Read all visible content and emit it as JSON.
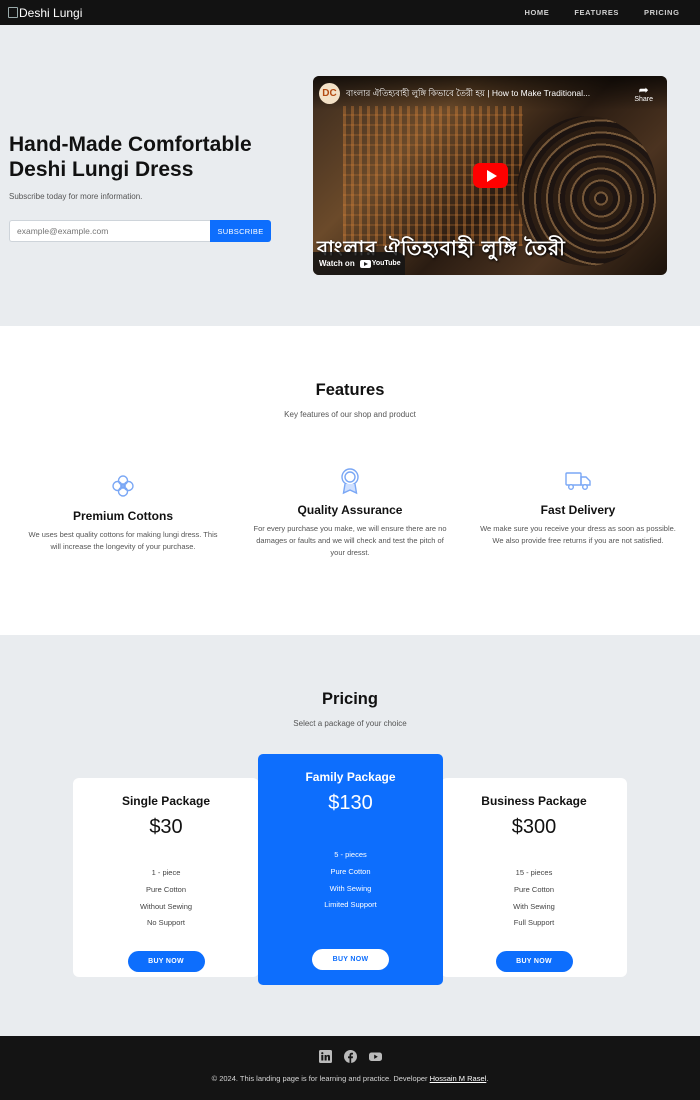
{
  "nav": {
    "brand_alt": "Deshi Lungi",
    "links": [
      "HOME",
      "FEATURES",
      "PRICING"
    ]
  },
  "hero": {
    "title_line1": "Hand-Made Comfortable",
    "title_line2": "Deshi Lungi Dress",
    "subtitle": "Subscribe today for more information.",
    "email_placeholder": "example@example.com",
    "subscribe_label": "SUBSCRIBE"
  },
  "video": {
    "channel_initials": "DC",
    "title": "বাংলার ঐতিহ্যবাহী লুঙ্গি কিভাবে তৈরী হয় | How to Make Traditional...",
    "share_label": "Share",
    "overlay_text": "বাংলার ঐতিহ্যবাহী লুঙ্গি তৈরী",
    "watch_on": "Watch on",
    "youtube": "YouTube"
  },
  "features": {
    "title": "Features",
    "subtitle": "Key features of our shop and product",
    "items": [
      {
        "icon": "flower-icon",
        "title": "Premium Cottons",
        "text": "We uses best quality cottons for making lungi dress. This will increase the longevity of your purchase."
      },
      {
        "icon": "award-icon",
        "title": "Quality Assurance",
        "text": "For every purchase you make, we will ensure there are no damages or faults and we will check and test the pitch of your dresst."
      },
      {
        "icon": "truck-icon",
        "title": "Fast Delivery",
        "text": "We make sure you receive your dress as soon as possible. We also provide free returns if you are not satisfied."
      }
    ]
  },
  "pricing": {
    "title": "Pricing",
    "subtitle": "Select a package of your choice",
    "plans": [
      {
        "name": "Single Package",
        "price": "$30",
        "features": [
          "1 - piece",
          "Pure Cotton",
          "Without Sewing",
          "No Support"
        ],
        "button": "BUY NOW"
      },
      {
        "name": "Family Package",
        "price": "$130",
        "features": [
          "5 - pieces",
          "Pure Cotton",
          "With Sewing",
          "Limited Support"
        ],
        "button": "BUY NOW"
      },
      {
        "name": "Business Package",
        "price": "$300",
        "features": [
          "15 - pieces",
          "Pure Cotton",
          "With Sewing",
          "Full Support"
        ],
        "button": "BUY NOW"
      }
    ]
  },
  "footer": {
    "social_icons": [
      "linkedin-icon",
      "facebook-icon",
      "youtube-icon"
    ],
    "copyright": "© 2024. This landing page is for learning and practice. Developer",
    "developer": "Hossain M Rasel",
    "period": "."
  },
  "colors": {
    "primary": "#0d6efd",
    "nav_bg": "#121212",
    "section_gray": "#e9ecef",
    "icon_blue": "#7aa7f5"
  }
}
